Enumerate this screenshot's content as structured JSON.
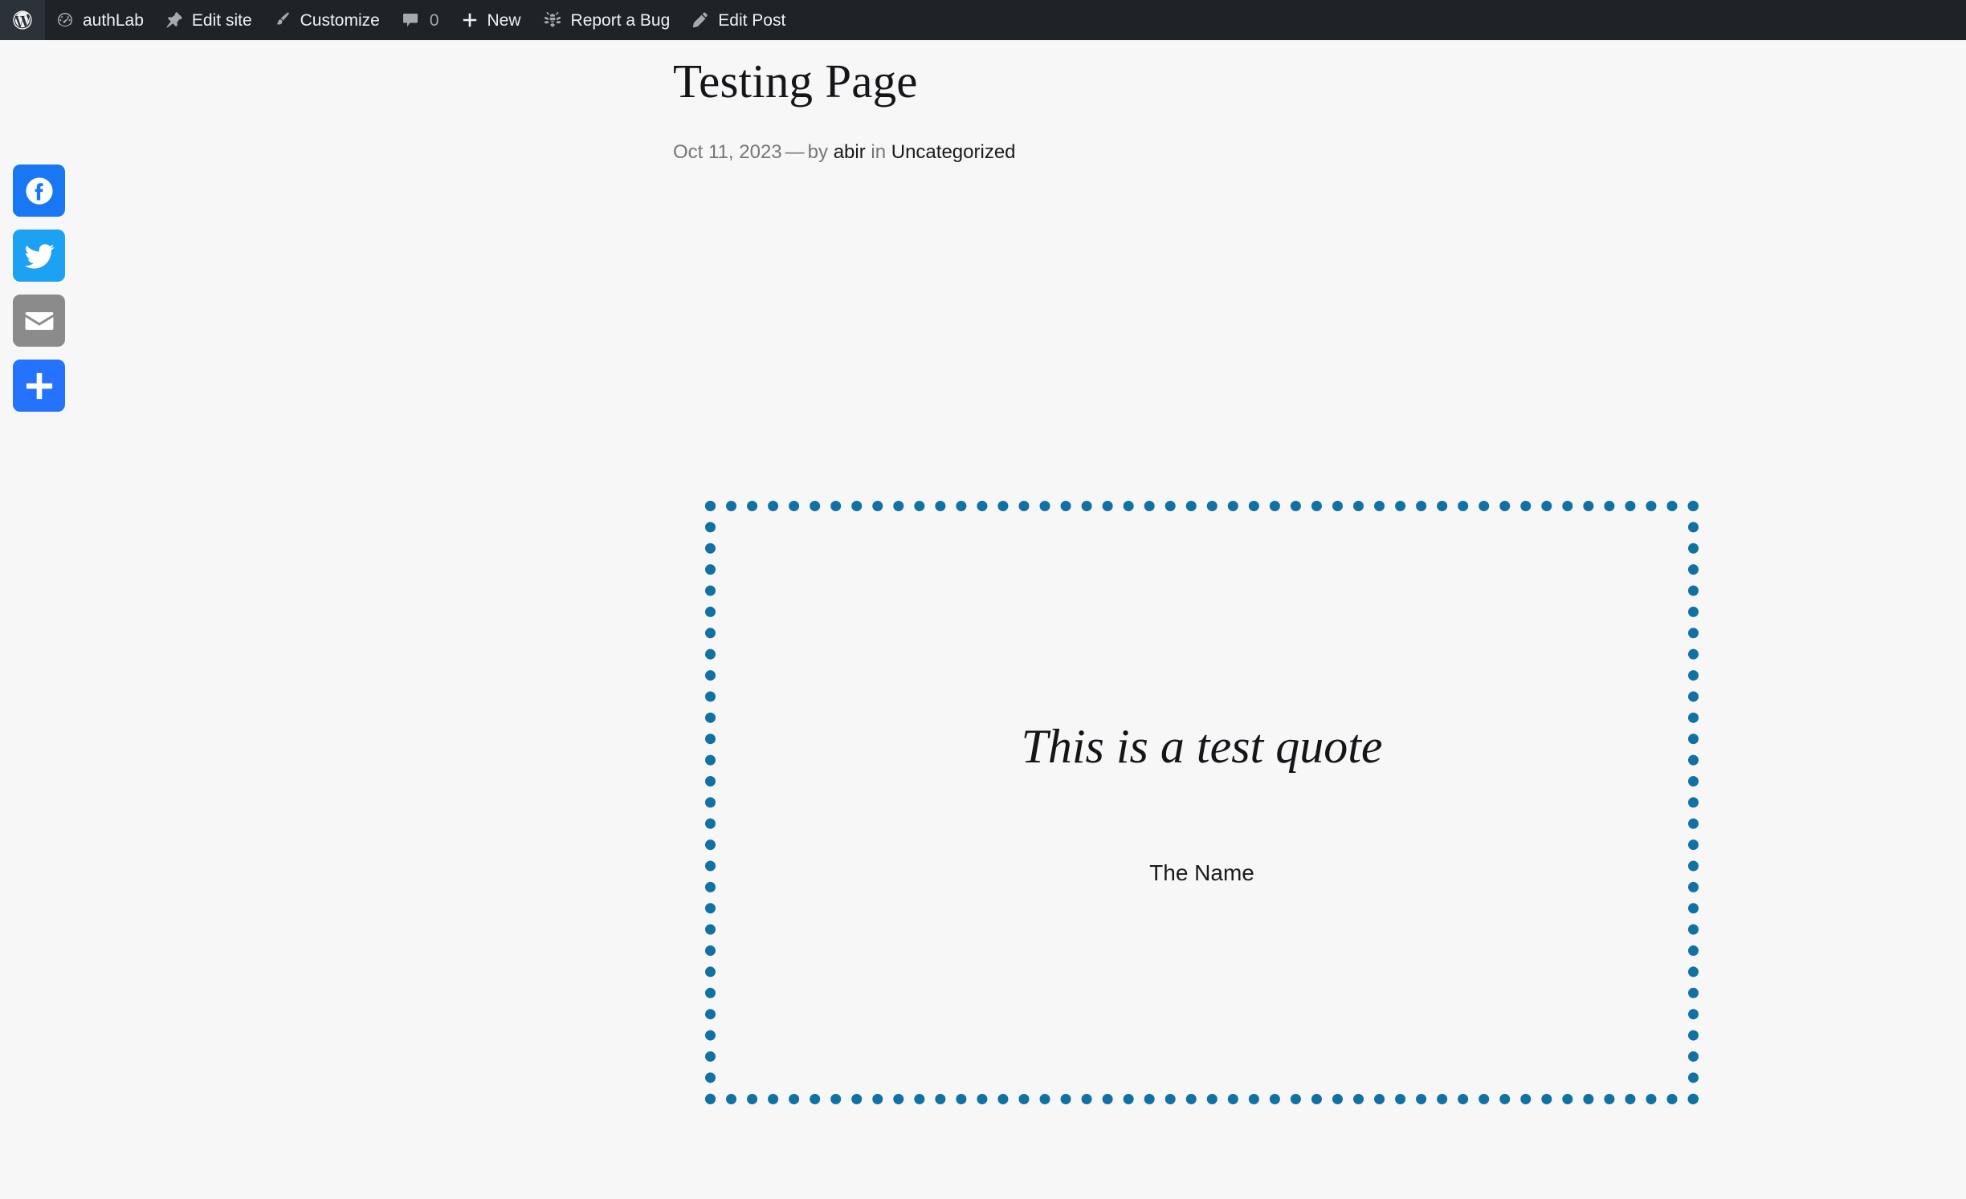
{
  "admin_bar": {
    "background": "#1d2327",
    "items": [
      {
        "id": "wp-logo",
        "icon": "wordpress-logo-icon",
        "label": ""
      },
      {
        "id": "site-name",
        "icon": "dashboard-icon",
        "label": "authLab"
      },
      {
        "id": "edit-site",
        "icon": "pin-icon",
        "label": "Edit site"
      },
      {
        "id": "customize",
        "icon": "paintbrush-icon",
        "label": "Customize"
      },
      {
        "id": "comments",
        "icon": "comment-bubble-icon",
        "label": "0"
      },
      {
        "id": "new-content",
        "icon": "plus-icon",
        "label": "New"
      },
      {
        "id": "report-a-bug",
        "icon": "bee-icon",
        "label": "Report a Bug"
      },
      {
        "id": "edit-post",
        "icon": "pencil-icon",
        "label": "Edit Post"
      }
    ]
  },
  "share_rail": {
    "buttons": [
      {
        "id": "facebook",
        "icon": "facebook-icon",
        "label": "Facebook",
        "color": "#1877f2"
      },
      {
        "id": "twitter",
        "icon": "twitter-bird-icon",
        "label": "Twitter",
        "color": "#1da1f2"
      },
      {
        "id": "email",
        "icon": "envelope-icon",
        "label": "Email",
        "color": "#8b8b8b"
      },
      {
        "id": "share",
        "icon": "plus-share-icon",
        "label": "Share",
        "color": "#2572ff"
      }
    ]
  },
  "post": {
    "title": "Testing Page",
    "meta": {
      "date": "Oct 11, 2023",
      "separator": "—",
      "by_label": "by",
      "author": "abir",
      "in_label": "in",
      "category": "Uncategorized"
    }
  },
  "pullquote": {
    "text": "This is a test quote",
    "citation": "The Name",
    "border_color": "#1171a3"
  },
  "page": {
    "background": "#f7f7f7"
  }
}
